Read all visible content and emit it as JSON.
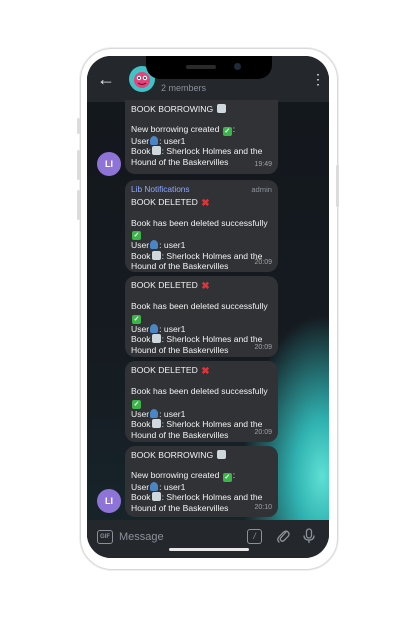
{
  "header": {
    "members": "2 members",
    "back_icon": "arrow-left-icon",
    "menu_icon": "more-vertical-icon"
  },
  "messages": [
    {
      "title": "BOOK BORROWING",
      "line1": "New borrowing created",
      "user_prefix": "User",
      "user": ": user1",
      "book_prefix": "Book",
      "book1": ":  Sherlock Holmes and the",
      "book2": "Hound of the Baskervilles",
      "time": "19:49"
    },
    {
      "sender": "Lib Notifications",
      "role": "admin",
      "title": "BOOK DELETED",
      "line1": "Book has been deleted successfully",
      "user_prefix": "User",
      "user": ": user1",
      "book_prefix": "Book",
      "book1": ":  Sherlock Holmes and the",
      "book2": "Hound of the Baskervilles",
      "time": "20:09"
    },
    {
      "title": "BOOK DELETED",
      "line1": "Book has been deleted successfully",
      "user_prefix": "User",
      "user": ": user1",
      "book_prefix": "Book",
      "book1": ":  Sherlock Holmes and the",
      "book2": "Hound of the Baskervilles",
      "time": "20:09"
    },
    {
      "title": "BOOK DELETED",
      "line1": "Book has been deleted successfully",
      "user_prefix": "User",
      "user": ": user1",
      "book_prefix": "Book",
      "book1": ":  Sherlock Holmes and the",
      "book2": "Hound of the Baskervilles",
      "time": "20:09"
    },
    {
      "title": "BOOK BORROWING",
      "line1": "New borrowing created",
      "user_prefix": "User",
      "user": ": user1",
      "book_prefix": "Book",
      "book1": ":  Sherlock Holmes and the",
      "book2": "Hound of the Baskervilles",
      "time": "20:10"
    }
  ],
  "avatar_initials": "LI",
  "input": {
    "placeholder": "Message",
    "gif_label": "GIF"
  },
  "colors": {
    "avatar": "#8f74d8",
    "bubble": "#303236",
    "sender": "#8fa8ff",
    "accent_glow": "#5fe0d4"
  }
}
